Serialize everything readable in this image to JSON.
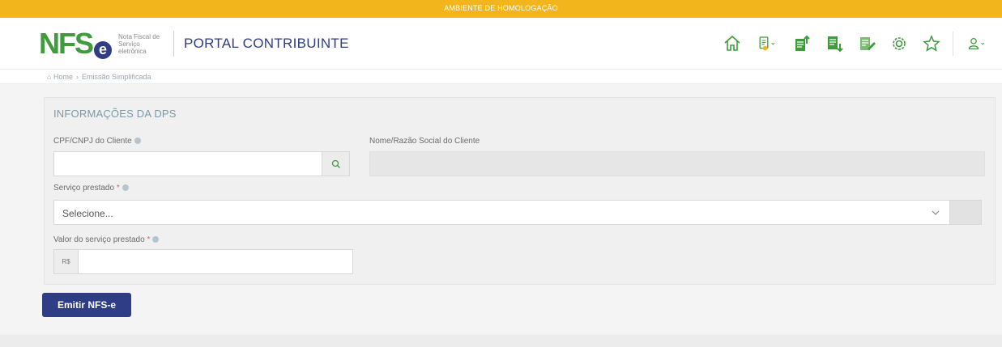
{
  "environment": {
    "label": "AMBIENTE DE HOMOLOGAÇÃO"
  },
  "header": {
    "logo_text_nf": "NFS",
    "logo_text_e": "e",
    "logo_subtitle_line1": "Nota Fiscal de",
    "logo_subtitle_line2": "Serviço eletrônica",
    "portal_title": "PORTAL CONTRIBUINTE",
    "icons": [
      "home-icon",
      "invoice-download-icon",
      "upload-document-icon",
      "download-document-icon",
      "edit-document-icon",
      "gear-icon",
      "star-icon",
      "user-icon"
    ],
    "accent_green": "#3f9b3c",
    "accent_blue": "#2e3d86"
  },
  "breadcrumb": {
    "home": "Home",
    "current": "Emissão Simplificada"
  },
  "form": {
    "section_title": "INFORMAÇÕES DA DPS",
    "cpf_label": "CPF/CNPJ do Cliente",
    "cpf_value": "",
    "name_label": "Nome/Razão Social do Cliente",
    "name_value": "",
    "service_label": "Serviço prestado",
    "service_selected": "Selecione...",
    "value_label": "Valor do serviço prestado",
    "value_prefix": "R$",
    "value_value": "",
    "required_mark": "*"
  },
  "actions": {
    "emit_label": "Emitir NFS-e"
  }
}
